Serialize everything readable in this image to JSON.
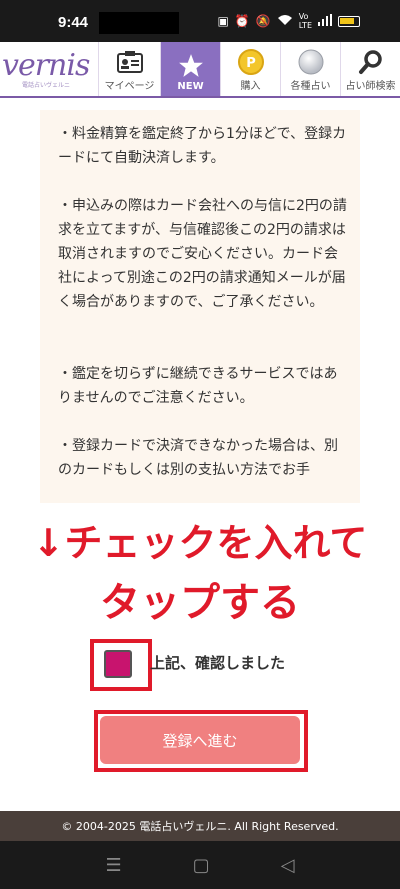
{
  "status_bar": {
    "time": "9:44",
    "icons": [
      "nfc-icon",
      "alarm-icon",
      "mute-icon",
      "wifi-icon",
      "volte-icon",
      "signal-icon",
      "battery-icon"
    ]
  },
  "header": {
    "logo_text": "vernis",
    "logo_sub": "電話占いヴェルニ",
    "nav": [
      {
        "label": "マイページ",
        "icon": "id-card-icon"
      },
      {
        "label": "NEW",
        "icon": "star-icon"
      },
      {
        "label": "購入",
        "icon": "coin-icon"
      },
      {
        "label": "各種占い",
        "icon": "crystal-ball-icon"
      },
      {
        "label": "占い師検索",
        "icon": "search-icon"
      }
    ]
  },
  "content": {
    "paragraphs": [
      "・料金精算を鑑定終了から1分ほどで、登録カードにて自動決済します。",
      "・申込みの際はカード会社への与信に2円の請求を立てますが、与信確認後この2円の請求は取消されますのでご安心ください。カード会社によって別途この2円の請求通知メールが届く場合がありますので、ご了承ください。",
      "・鑑定を切らずに継続できるサービスではありませんのでご注意ください。",
      "・登録カードで決済できなかった場合は、別のカードもしくは別の支払い方法でお手"
    ]
  },
  "annotation": {
    "line1": "↓チェックを入れて",
    "line2": "タップする",
    "color": "#e01a2a"
  },
  "form": {
    "checkbox_label": "上記、確認しました",
    "submit_label": "登録へ進む"
  },
  "footer": {
    "copyright": "© 2004-2025 電話占いヴェルニ. All Right Reserved."
  },
  "colors": {
    "brand": "#7a5aa8",
    "nav_new": "#8a6fc0",
    "checkbox": "#c8146e",
    "submit": "#f08080",
    "content_bg": "#fdf6ee",
    "footer_bg": "#4a3f3a"
  }
}
